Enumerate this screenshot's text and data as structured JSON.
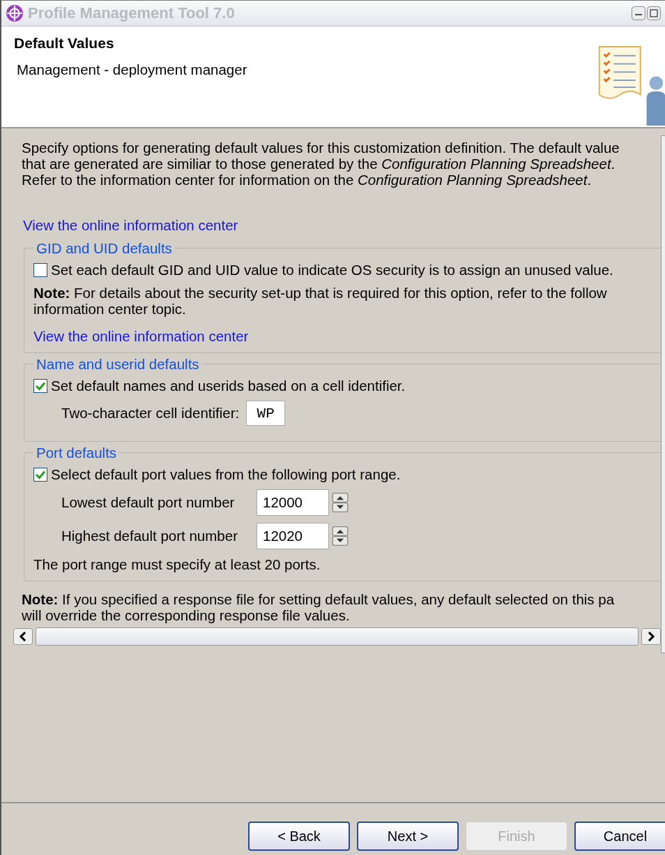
{
  "window": {
    "title": "Profile Management Tool 7.0"
  },
  "header": {
    "title": "Default Values",
    "subtitle": "Management - deployment manager"
  },
  "intro_lines": [
    "Specify options for generating default values for this customization definition. The default value",
    "that are generated are similiar to those generated by the *Configuration Planning Spreadsheet*.",
    "Refer to the information center for information on the *Configuration Planning Spreadsheet*."
  ],
  "link": "View the online information center",
  "groups": [
    {
      "title": "GID and UID defaults",
      "rows": [
        {
          "kind": "checkbox",
          "label": "Set each default GID and UID value to indicate OS security is to assign an unused value.",
          "checked": false
        },
        {
          "kind": "note",
          "lines": [
            "**Note:** For details about the security set-up that is required for this option, refer to the follow",
            "information center topic."
          ]
        },
        {
          "kind": "link",
          "label": "View the online information center"
        }
      ]
    },
    {
      "title": "Name and userid defaults",
      "rows": [
        {
          "kind": "checkbox",
          "label": "Set default names and userids based on a cell identifier.",
          "checked": true
        },
        {
          "kind": "field",
          "label": "Two-character cell identifier:",
          "value": "WP"
        }
      ]
    },
    {
      "title": "Port defaults",
      "rows": [
        {
          "kind": "checkbox",
          "label": "Select default port values from the following port range.",
          "checked": true
        },
        {
          "kind": "spinner",
          "label": "Lowest default port number",
          "value": "12000"
        },
        {
          "kind": "spinner",
          "label": "Highest default port number",
          "value": "12020"
        },
        {
          "kind": "text",
          "label": "The port range must specify at least 20 ports."
        }
      ]
    }
  ],
  "note_lines": [
    "**Note:** If you specified a response file for setting default values, any default selected on this pa",
    "will override the corresponding response file values."
  ],
  "buttons": [
    {
      "label": "< Back",
      "disabled": false
    },
    {
      "label": "Next >",
      "disabled": false
    },
    {
      "label": "Finish",
      "disabled": true
    },
    {
      "label": "Cancel",
      "disabled": false
    }
  ]
}
